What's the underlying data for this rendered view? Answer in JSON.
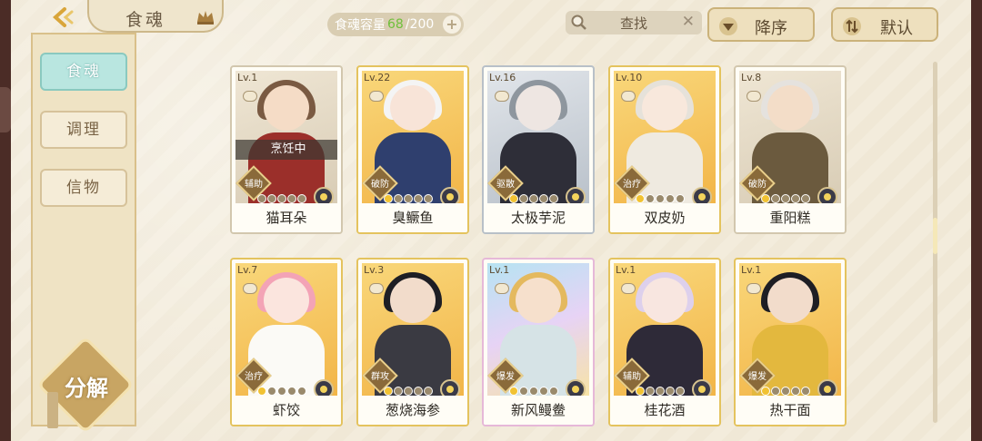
{
  "header": {
    "title": "食魂",
    "capacity_label": "食魂容量",
    "capacity_current": "68",
    "capacity_total": "/200",
    "search_label": "查找",
    "sort_order_label": "降序",
    "sort_mode_label": "默认"
  },
  "sidebar": {
    "items": [
      {
        "label": "食魂",
        "active": true
      },
      {
        "label": "调理",
        "active": false
      },
      {
        "label": "信物",
        "active": false
      }
    ],
    "decompose_label": "分解"
  },
  "cards": [
    {
      "level": "Lv.1",
      "name": "猫耳朵",
      "role": "辅助",
      "stars": 0,
      "status": "烹饪中",
      "rarity": "plain",
      "hair": "#7a5a42",
      "skin": "#f5dcc6",
      "outfit": "#9b2f2a"
    },
    {
      "level": "Lv.22",
      "name": "臭鳜鱼",
      "role": "破防",
      "stars": 1,
      "status": "",
      "rarity": "gold",
      "hair": "#f4f4f4",
      "skin": "#f8e4d8",
      "outfit": "#2f3f6e"
    },
    {
      "level": "Lv.16",
      "name": "太极芋泥",
      "role": "驱散",
      "stars": 1,
      "status": "",
      "rarity": "silver",
      "hair": "#8e969e",
      "skin": "#eee6e2",
      "outfit": "#2e2e38"
    },
    {
      "level": "Lv.10",
      "name": "双皮奶",
      "role": "治疗",
      "stars": 1,
      "status": "",
      "rarity": "gold",
      "hair": "#e6e2da",
      "skin": "#f8e8dc",
      "outfit": "#efeae0"
    },
    {
      "level": "Lv.8",
      "name": "重阳糕",
      "role": "破防",
      "stars": 1,
      "status": "",
      "rarity": "plain",
      "hair": "#e5e2de",
      "skin": "#f3ddc8",
      "outfit": "#6b5a3e"
    },
    {
      "level": "Lv.7",
      "name": "虾饺",
      "role": "治疗",
      "stars": 1,
      "status": "",
      "rarity": "gold",
      "hair": "#f3a3b6",
      "skin": "#fbe5de",
      "outfit": "#fbfaf6"
    },
    {
      "level": "Lv.3",
      "name": "葱烧海参",
      "role": "群攻",
      "stars": 1,
      "status": "",
      "rarity": "gold",
      "hair": "#1e1e24",
      "skin": "#f2dccb",
      "outfit": "#3a3a42"
    },
    {
      "level": "Lv.1",
      "name": "新风鳗鲞",
      "role": "爆发",
      "stars": 1,
      "status": "",
      "rarity": "rainbow",
      "hair": "#e4b95e",
      "skin": "#f6e0cc",
      "outfit": "#d6e3e6"
    },
    {
      "level": "Lv.1",
      "name": "桂花酒",
      "role": "辅助",
      "stars": 1,
      "status": "",
      "rarity": "gold",
      "hair": "#ddd0ec",
      "skin": "#f8e6e0",
      "outfit": "#2e2a38"
    },
    {
      "level": "Lv.1",
      "name": "热干面",
      "role": "爆发",
      "stars": 1,
      "status": "",
      "rarity": "gold",
      "hair": "#1e1e24",
      "skin": "#f2dccb",
      "outfit": "#e3b83e"
    }
  ]
}
